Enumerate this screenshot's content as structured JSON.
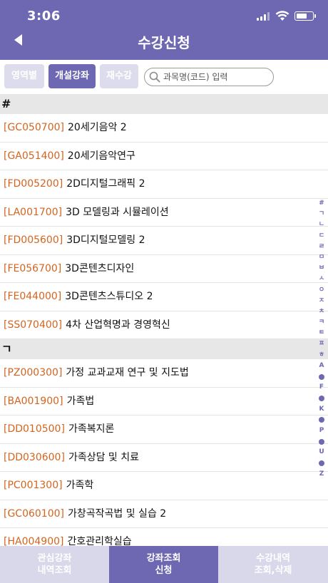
{
  "status": {
    "time": "3:06"
  },
  "header": {
    "title": "수강신청"
  },
  "toolbar": {
    "tabs": [
      {
        "label": "영역별",
        "active": false
      },
      {
        "label": "개설강좌",
        "active": true
      },
      {
        "label": "재수강",
        "active": false
      }
    ],
    "search": {
      "placeholder": "과목명(코드) 입력"
    }
  },
  "sections": [
    {
      "header": "#",
      "items": [
        {
          "code": "[GC050700]",
          "name": "20세기음악 2"
        },
        {
          "code": "[GA051400]",
          "name": "20세기음악연구"
        },
        {
          "code": "[FD005200]",
          "name": "2D디지털그래픽 2"
        },
        {
          "code": "[LA001700]",
          "name": "3D 모델링과 시뮬레이션"
        },
        {
          "code": "[FD005600]",
          "name": "3D디지털모델링 2"
        },
        {
          "code": "[FE056700]",
          "name": "3D콘텐츠디자인"
        },
        {
          "code": "[FE044000]",
          "name": "3D콘텐츠스튜디오 2"
        },
        {
          "code": "[SS070400]",
          "name": "4차 산업혁명과 경영혁신"
        }
      ]
    },
    {
      "header": "ㄱ",
      "items": [
        {
          "code": "[PZ000300]",
          "name": "가정 교과교재 연구 및 지도법"
        },
        {
          "code": "[BA001900]",
          "name": "가족법"
        },
        {
          "code": "[DD010500]",
          "name": "가족복지론"
        },
        {
          "code": "[DD030600]",
          "name": "가족상담 및 치료"
        },
        {
          "code": "[PC001300]",
          "name": "가족학"
        },
        {
          "code": "[GC060100]",
          "name": "가창곡작곡법 및 실습 2"
        },
        {
          "code": "[HA004900]",
          "name": "간호관리학실습"
        }
      ]
    }
  ],
  "index": [
    "#",
    "ㄱ",
    "ㄴ",
    "ㄷ",
    "ㄹ",
    "ㅁ",
    "ㅂ",
    "ㅅ",
    "ㅇ",
    "ㅈ",
    "ㅊ",
    "ㅋ",
    "ㅌ",
    "ㅍ",
    "ㅎ",
    "A",
    "•",
    "F",
    "•",
    "K",
    "•",
    "P",
    "•",
    "U",
    "•",
    "Z"
  ],
  "bottom_tabs": [
    {
      "line1": "관심강좌",
      "line2": "내역조회",
      "active": false
    },
    {
      "line1": "강좌조회",
      "line2": "신청",
      "active": true
    },
    {
      "line1": "수강내역",
      "line2": "조회,삭제",
      "active": false
    }
  ],
  "colors": {
    "accent": "#6e68b3",
    "code": "#d4641f",
    "section_bg": "#e7e7e7",
    "tab_idle": "#dcdcec"
  }
}
